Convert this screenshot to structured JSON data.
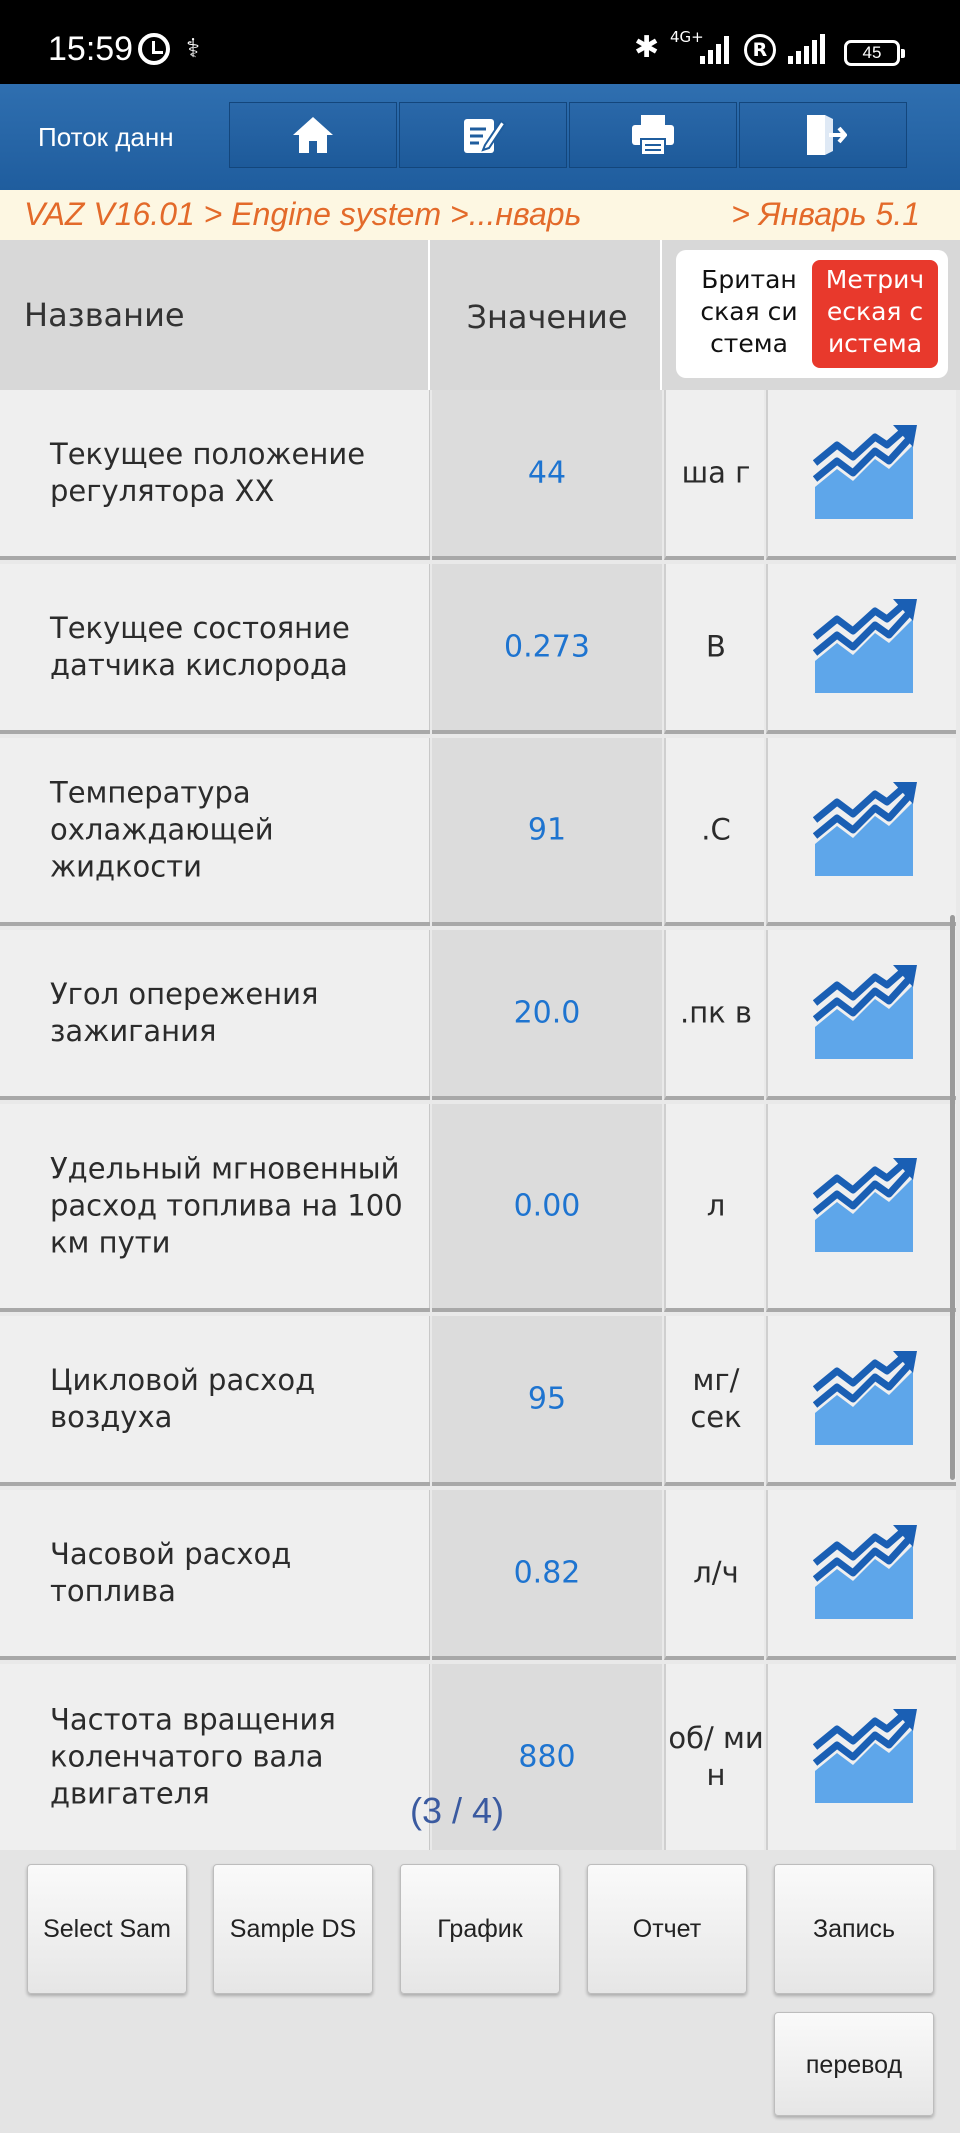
{
  "status_bar": {
    "time": "15:59",
    "network": "4G+",
    "roaming": "R",
    "battery": "45"
  },
  "app_bar": {
    "title": "Поток данн",
    "buttons": [
      {
        "icon": "home-icon"
      },
      {
        "icon": "edit-icon"
      },
      {
        "icon": "print-icon"
      },
      {
        "icon": "exit-icon"
      }
    ]
  },
  "breadcrumb": {
    "path": "VAZ V16.01 > Engine system >...нварь",
    "suffix": "> Январь  5.1"
  },
  "table": {
    "col_name": "Название",
    "col_value": "Значение",
    "unit_system": {
      "british": "Британ ская си стема",
      "metric": "Метрич еская с истема",
      "selected": "metric"
    },
    "rows": [
      {
        "name": "Текущее положение регулятора ХХ",
        "value": "44",
        "unit": "ша г"
      },
      {
        "name": "Текущее состояние датчика кислорода",
        "value": "0.273",
        "unit": "В"
      },
      {
        "name": "Температура охлаждающей жидкости",
        "value": "91",
        "unit": ".С"
      },
      {
        "name": "Угол опережения зажигания",
        "value": "20.0",
        "unit": ".пк в"
      },
      {
        "name": "Удельный мгновенный расход топлива на 100 км пути",
        "value": "0.00",
        "unit": "л"
      },
      {
        "name": "Цикловой расход воздуха",
        "value": "95",
        "unit": "мг/ сек"
      },
      {
        "name": "Часовой расход топлива",
        "value": "0.82",
        "unit": "л/ч"
      },
      {
        "name": "Частота вращения коленчатого вала двигателя",
        "value": "880",
        "unit": "об/ ми н"
      }
    ]
  },
  "pager": "(3 / 4)",
  "bottom_buttons": {
    "select_sample": "Select Sam",
    "sample_ds": "Sample DS",
    "graph": "График",
    "report": "Отчет",
    "record": "Запись",
    "translate": "перевод"
  },
  "colors": {
    "app_bar": "#1f5d9e",
    "breadcrumb_text": "#e36a2a",
    "value_text": "#1e74d0",
    "metric_active": "#e8392c"
  }
}
